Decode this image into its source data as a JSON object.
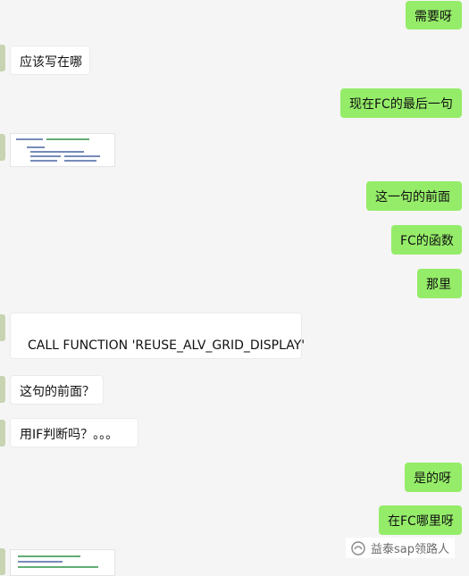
{
  "messages": {
    "m1": "需要呀",
    "m2": "应该写在哪",
    "m3": "现在FC的最后一句",
    "m4": "这一句的前面",
    "m5": "FC的函数",
    "m6": "那里",
    "m7": "CALL FUNCTION 'REUSE_ALV_GRID_DISPLAY'",
    "m8": "这句的前面？",
    "m9": "用IF判断吗？。。。",
    "m10": "是的呀",
    "m11": "在FC哪里呀"
  },
  "watermark": {
    "text": "益泰sap领路人",
    "icon": "wechat-official-account-icon"
  },
  "colors": {
    "outgoing": "#95ec69",
    "incoming": "#ffffff",
    "background": "#f5f5f5"
  }
}
